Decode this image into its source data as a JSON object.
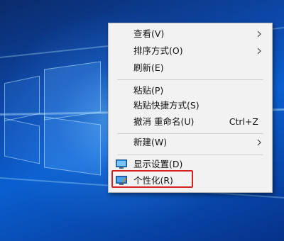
{
  "context_menu": {
    "items": [
      {
        "label": "查看(V)",
        "has_submenu": true
      },
      {
        "label": "排序方式(O)",
        "has_submenu": true
      },
      {
        "label": "刷新(E)"
      },
      {
        "label": "粘贴(P)"
      },
      {
        "label": "粘贴快捷方式(S)"
      },
      {
        "label": "撤消 重命名(U)",
        "shortcut": "Ctrl+Z"
      },
      {
        "label": "新建(W)",
        "has_submenu": true
      },
      {
        "label": "显示设置(D)",
        "icon": "display-settings-icon"
      },
      {
        "label": "个性化(R)",
        "icon": "personalize-icon",
        "highlighted": true
      }
    ]
  },
  "colors": {
    "highlight_border": "#d42222",
    "menu_background": "#f2f2f2",
    "desktop_accent": "#0a5fd0"
  }
}
